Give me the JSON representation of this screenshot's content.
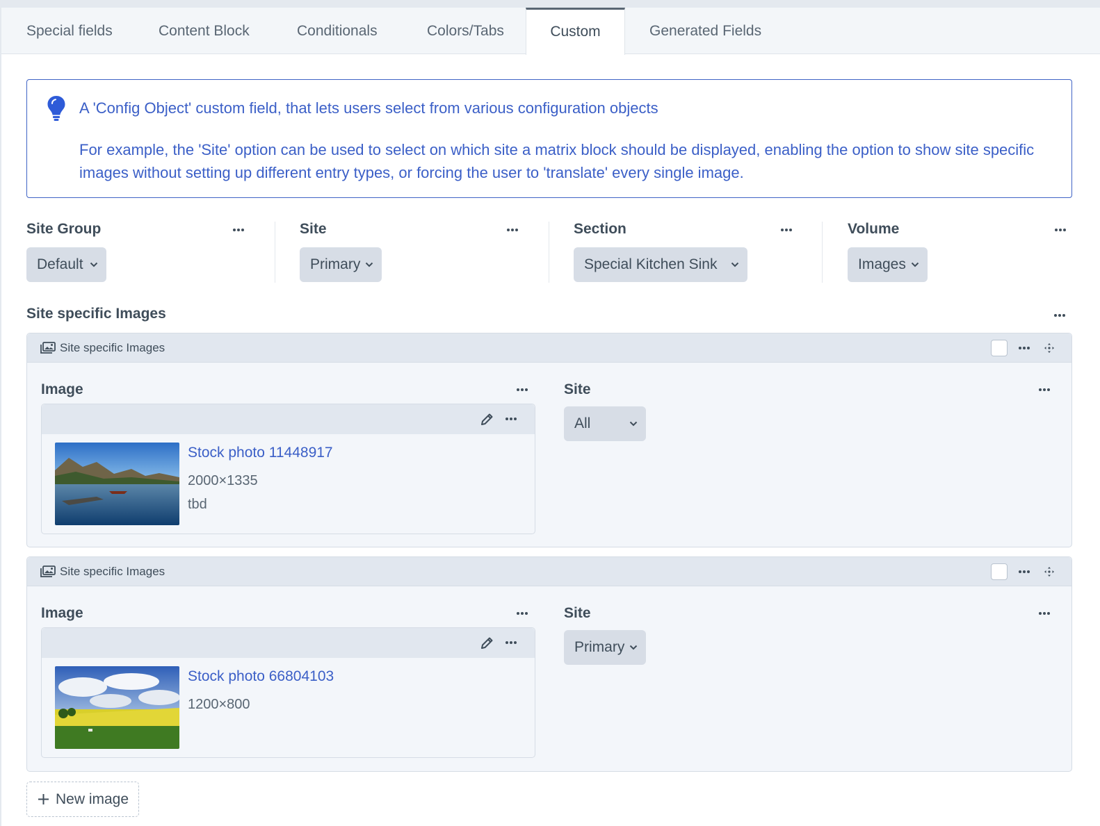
{
  "tabs": [
    {
      "label": "Special fields"
    },
    {
      "label": "Content Block"
    },
    {
      "label": "Conditionals"
    },
    {
      "label": "Colors/Tabs"
    },
    {
      "label": "Custom"
    },
    {
      "label": "Generated Fields"
    }
  ],
  "active_tab": "Custom",
  "tip": {
    "icon": "lightbulb-icon",
    "line1": "A 'Config Object' custom field, that lets users select from various configuration objects",
    "line2": "For example, the 'Site' option can be used to select on which site a matrix block should be displayed, enabling the option to show site specific images without setting up different entry types, or forcing the user to 'translate' every single image."
  },
  "fields": {
    "site_group": {
      "label": "Site Group",
      "value": "Default"
    },
    "site": {
      "label": "Site",
      "value": "Primary"
    },
    "section": {
      "label": "Section",
      "value": "Special Kitchen Sink"
    },
    "volume": {
      "label": "Volume",
      "value": "Images"
    }
  },
  "matrix": {
    "label": "Site specific Images",
    "blocks": [
      {
        "title": "Site specific Images",
        "image_label": "Image",
        "site_label": "Site",
        "site_value": "All",
        "asset": {
          "title": "Stock photo 11448917",
          "dimensions": "2000×1335",
          "extra": "tbd"
        }
      },
      {
        "title": "Site specific Images",
        "image_label": "Image",
        "site_label": "Site",
        "site_value": "Primary",
        "asset": {
          "title": "Stock photo 66804103",
          "dimensions": "1200×800"
        }
      }
    ],
    "new_button": "New image"
  },
  "colors": {
    "link": "#3b5fc7",
    "tip_border": "#3f63c5",
    "select_bg": "#d7dde6",
    "block_bg": "#f3f6fa"
  }
}
